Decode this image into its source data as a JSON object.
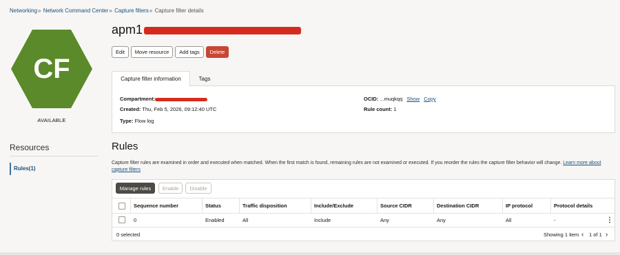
{
  "breadcrumb": {
    "items": [
      "Networking",
      "Network Command Center",
      "Capture filters"
    ],
    "current": "Capture filter details",
    "separator": "»"
  },
  "badge": {
    "initials": "CF",
    "status": "AVAILABLE",
    "color": "#5a8a2a"
  },
  "resources": {
    "title": "Resources",
    "items": [
      {
        "label": "Rules(1)"
      }
    ]
  },
  "header": {
    "title_prefix": "apm1"
  },
  "actions": {
    "edit": "Edit",
    "move": "Move resource",
    "add_tags": "Add tags",
    "delete": "Delete"
  },
  "tabs": {
    "info": "Capture filter information",
    "tags": "Tags"
  },
  "info": {
    "compartment_label": "Compartment:",
    "created_label": "Created:",
    "created_value": "Thu, Feb 5, 2026, 09:12:40 UTC",
    "type_label": "Type:",
    "type_value": "Flow log",
    "ocid_label": "OCID:",
    "ocid_value": "...muqkqq",
    "show_link": "Show",
    "copy_link": "Copy",
    "rule_count_label": "Rule count:",
    "rule_count_value": "1"
  },
  "rules": {
    "title": "Rules",
    "description": "Capture filter rules are examined in order and executed when matched. When the first match is found, remaining rules are not examined or executed. If you reorder the rules the capture filter behavior will change.",
    "learn_more": "Learn more about capture filters",
    "buttons": {
      "manage": "Manage rules",
      "enable": "Enable",
      "disable": "Disable"
    },
    "columns": [
      "Sequence number",
      "Status",
      "Traffic disposition",
      "Include/Exclude",
      "Source CIDR",
      "Destination CIDR",
      "IP protocol",
      "Protocol details"
    ],
    "rows": [
      [
        "0",
        "Enabled",
        "All",
        "Include",
        "Any",
        "Any",
        "All",
        "-"
      ]
    ],
    "selected": "0 selected",
    "showing": "Showing 1 item",
    "pagination": "1 of 1"
  }
}
